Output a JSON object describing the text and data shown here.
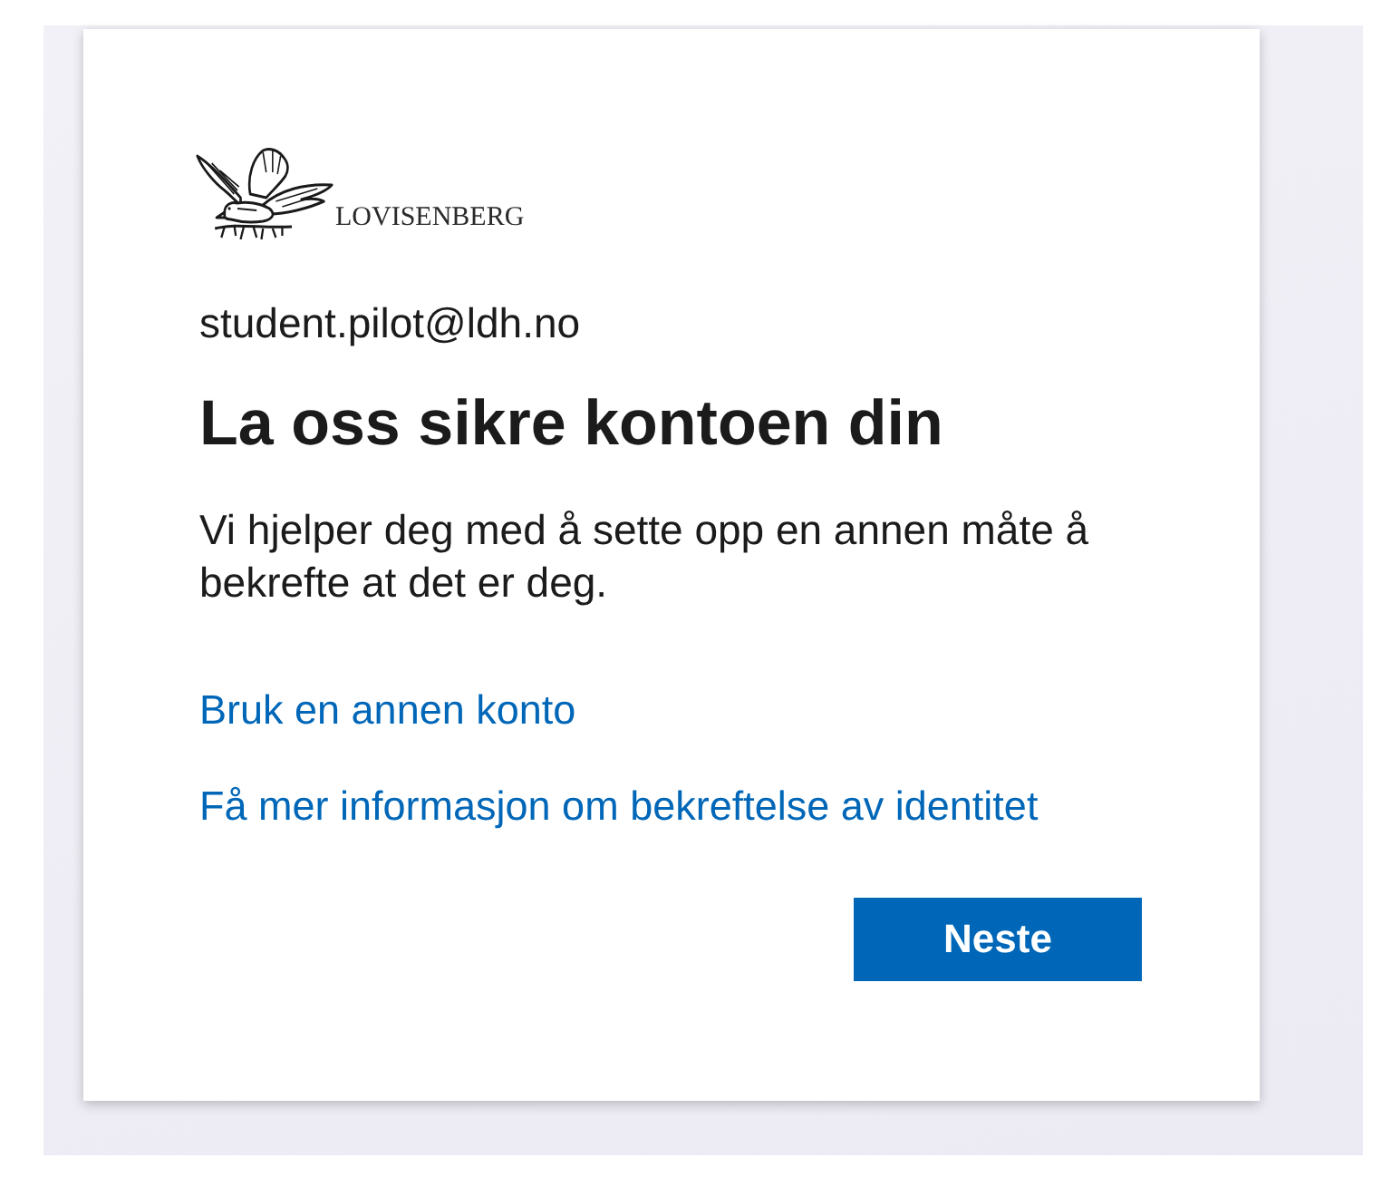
{
  "logo": {
    "text": "LOVISENBERG"
  },
  "account": {
    "email": "student.pilot@ldh.no"
  },
  "title": "La oss sikre kontoen din",
  "description": "Vi hjelper deg med å sette opp en annen måte å bekrefte at det er deg.",
  "links": [
    "Bruk en annen konto",
    "Få mer informasjon om bekreftelse av identitet"
  ],
  "next_button": {
    "label": "Neste"
  }
}
